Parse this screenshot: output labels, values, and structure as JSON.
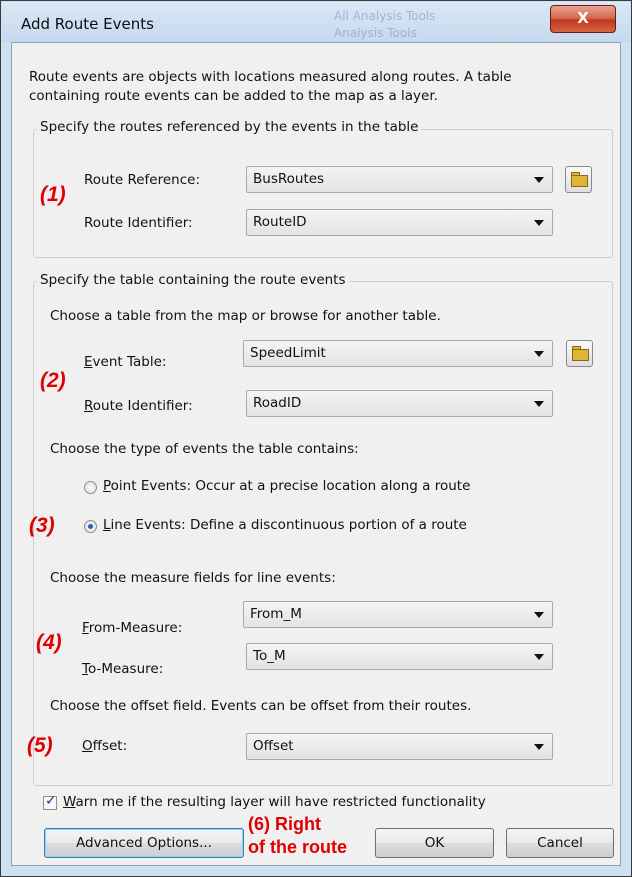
{
  "window": {
    "title": "Add Route Events",
    "close_glyph": "X"
  },
  "background_items": [
    "All Analysis Tools",
    "Analysis Tools"
  ],
  "intro_text": [
    "Route events are objects with locations measured along routes. A table",
    "containing route events can be added to the map as a layer."
  ],
  "routes_group": {
    "legend": "Specify the routes referenced by the events in the table",
    "route_reference_label": "Route Reference:",
    "route_reference_value": "BusRoutes",
    "route_identifier_label": "Route Identifier:",
    "route_identifier_value": "RouteID"
  },
  "events_group": {
    "legend": "Specify the table containing the route events",
    "choose_table_text": "Choose a table from the map or browse for another table.",
    "event_table_label": {
      "mnemonic": "E",
      "rest": "vent Table:"
    },
    "event_table_value": "SpeedLimit",
    "route_identifier_label": {
      "mnemonic": "R",
      "rest": "oute Identifier:"
    },
    "route_identifier_value": "RoadID",
    "type_text": "Choose the type of events the table contains:",
    "point_events": {
      "mnemonic": "P",
      "rest": "oint Events: Occur at a precise location along a route",
      "selected": false
    },
    "line_events": {
      "mnemonic": "L",
      "rest": "ine Events: Define a discontinuous portion of a route",
      "selected": true
    },
    "measure_text": "Choose the measure fields for line events:",
    "from_measure_label": {
      "mnemonic": "F",
      "rest": "rom-Measure:"
    },
    "from_measure_value": "From_M",
    "to_measure_label": {
      "mnemonic": "T",
      "rest": "o-Measure:"
    },
    "to_measure_value": "To_M",
    "offset_text": "Choose the offset field. Events can be offset from their routes.",
    "offset_label": {
      "mnemonic": "O",
      "rest": "ffset:"
    },
    "offset_value": "Offset"
  },
  "warn_checkbox": {
    "mnemonic": "W",
    "rest": "arn me if the resulting layer will have restricted functionality",
    "checked": true
  },
  "buttons": {
    "advanced": "Advanced Options...",
    "ok": "OK",
    "cancel": "Cancel"
  },
  "annotations": {
    "a1": "(1)",
    "a2": "(2)",
    "a3": "(3)",
    "a4": "(4)",
    "a5": "(5)",
    "a6_line1": "(6) Right",
    "a6_line2": "of the route"
  },
  "colors": {
    "annotation": "#e00000",
    "title_bar": "#c5d9ee",
    "dialog_bg": "#f0f0f0"
  },
  "icons": {
    "folder": "open-folder-icon",
    "dropdown": "chevron-down-icon"
  }
}
